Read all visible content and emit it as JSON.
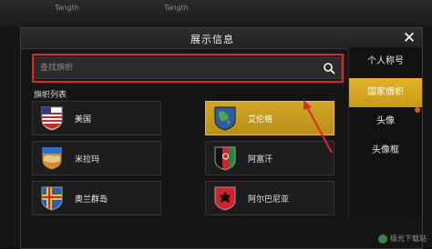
{
  "dialog": {
    "title": "展示信息",
    "close_symbol": "✕"
  },
  "search": {
    "placeholder": "查找旗帜"
  },
  "list": {
    "label": "旗帜列表"
  },
  "flags": [
    {
      "name": "美国",
      "selected": false
    },
    {
      "name": "艾伦格",
      "selected": true
    },
    {
      "name": "米拉玛",
      "selected": false
    },
    {
      "name": "阿富汗",
      "selected": false
    },
    {
      "name": "奥兰群岛",
      "selected": false
    },
    {
      "name": "阿尔巴尼亚",
      "selected": false
    }
  ],
  "sidebar": {
    "tabs": [
      {
        "label": "个人称号",
        "active": false
      },
      {
        "label": "国家旗帜",
        "active": true
      },
      {
        "label": "头像",
        "active": false
      },
      {
        "label": "头像框",
        "active": false
      }
    ]
  },
  "background": {
    "ghost_text": "Tangth"
  },
  "watermark": {
    "text": "极光下载站"
  },
  "colors": {
    "accent_gold": "#d2a624",
    "highlight_red": "#e0242a",
    "dialog_bg": "#151515"
  }
}
